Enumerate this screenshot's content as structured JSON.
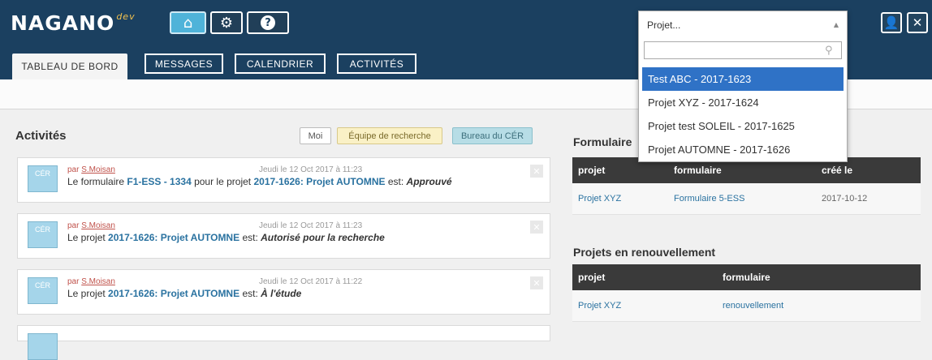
{
  "header": {
    "logo_text": "NAGANO",
    "logo_suffix": "dev",
    "icons": [
      "home-icon",
      "gear-icon",
      "help-icon",
      "user-icon",
      "close-icon"
    ]
  },
  "tabs": [
    {
      "label": "TABLEAU DE BORD",
      "active": true
    },
    {
      "label": "MESSAGES",
      "active": false
    },
    {
      "label": "CALENDRIER",
      "active": false
    },
    {
      "label": "ACTIVITÉS",
      "active": false
    }
  ],
  "activities": {
    "title": "Activités",
    "filters": [
      "Moi",
      "Équipe de recherche",
      "Bureau du CÉR"
    ],
    "items": [
      {
        "avatar": "CÉR",
        "author_prefix": "par ",
        "author": "S.Moisan",
        "date": "Jeudi le 12 Oct 2017 à 11:23",
        "t1": "Le formulaire ",
        "l1": "F1-ESS - 1334",
        "t2": " pour le projet ",
        "l2": "2017-1626: Projet AUTOMNE",
        "t3": " est: ",
        "status": "Approuvé"
      },
      {
        "avatar": "CÉR",
        "author_prefix": "par ",
        "author": "S.Moisan",
        "date": "Jeudi le 12 Oct 2017 à 11:23",
        "t1": "Le projet ",
        "l1": "2017-1626: Projet AUTOMNE",
        "t2": " est: ",
        "status": "Autorisé pour la recherche"
      },
      {
        "avatar": "CÉR",
        "author_prefix": "par ",
        "author": "S.Moisan",
        "date": "Jeudi le 12 Oct 2017 à 11:22",
        "t1": "Le projet ",
        "l1": "2017-1626: Projet AUTOMNE",
        "t2": " est: ",
        "status": "À l'étude"
      }
    ]
  },
  "formulaires": {
    "title": "Formulaire",
    "headers": [
      "projet",
      "formulaire",
      "créé le"
    ],
    "rows": [
      [
        "Projet XYZ",
        "Formulaire 5-ESS",
        "2017-10-12"
      ]
    ]
  },
  "renouvellement": {
    "title": "Projets en renouvellement",
    "headers": [
      "projet",
      "formulaire"
    ],
    "rows": [
      [
        "Projet XYZ",
        "renouvellement"
      ]
    ]
  },
  "project_select": {
    "label": "Projet...",
    "search_value": "",
    "options": [
      "Test ABC - 2017-1623",
      "Projet XYZ - 2017-1624",
      "Projet test SOLEIL - 2017-1625",
      "Projet AUTOMNE - 2017-1626"
    ],
    "selected_index": 0
  }
}
